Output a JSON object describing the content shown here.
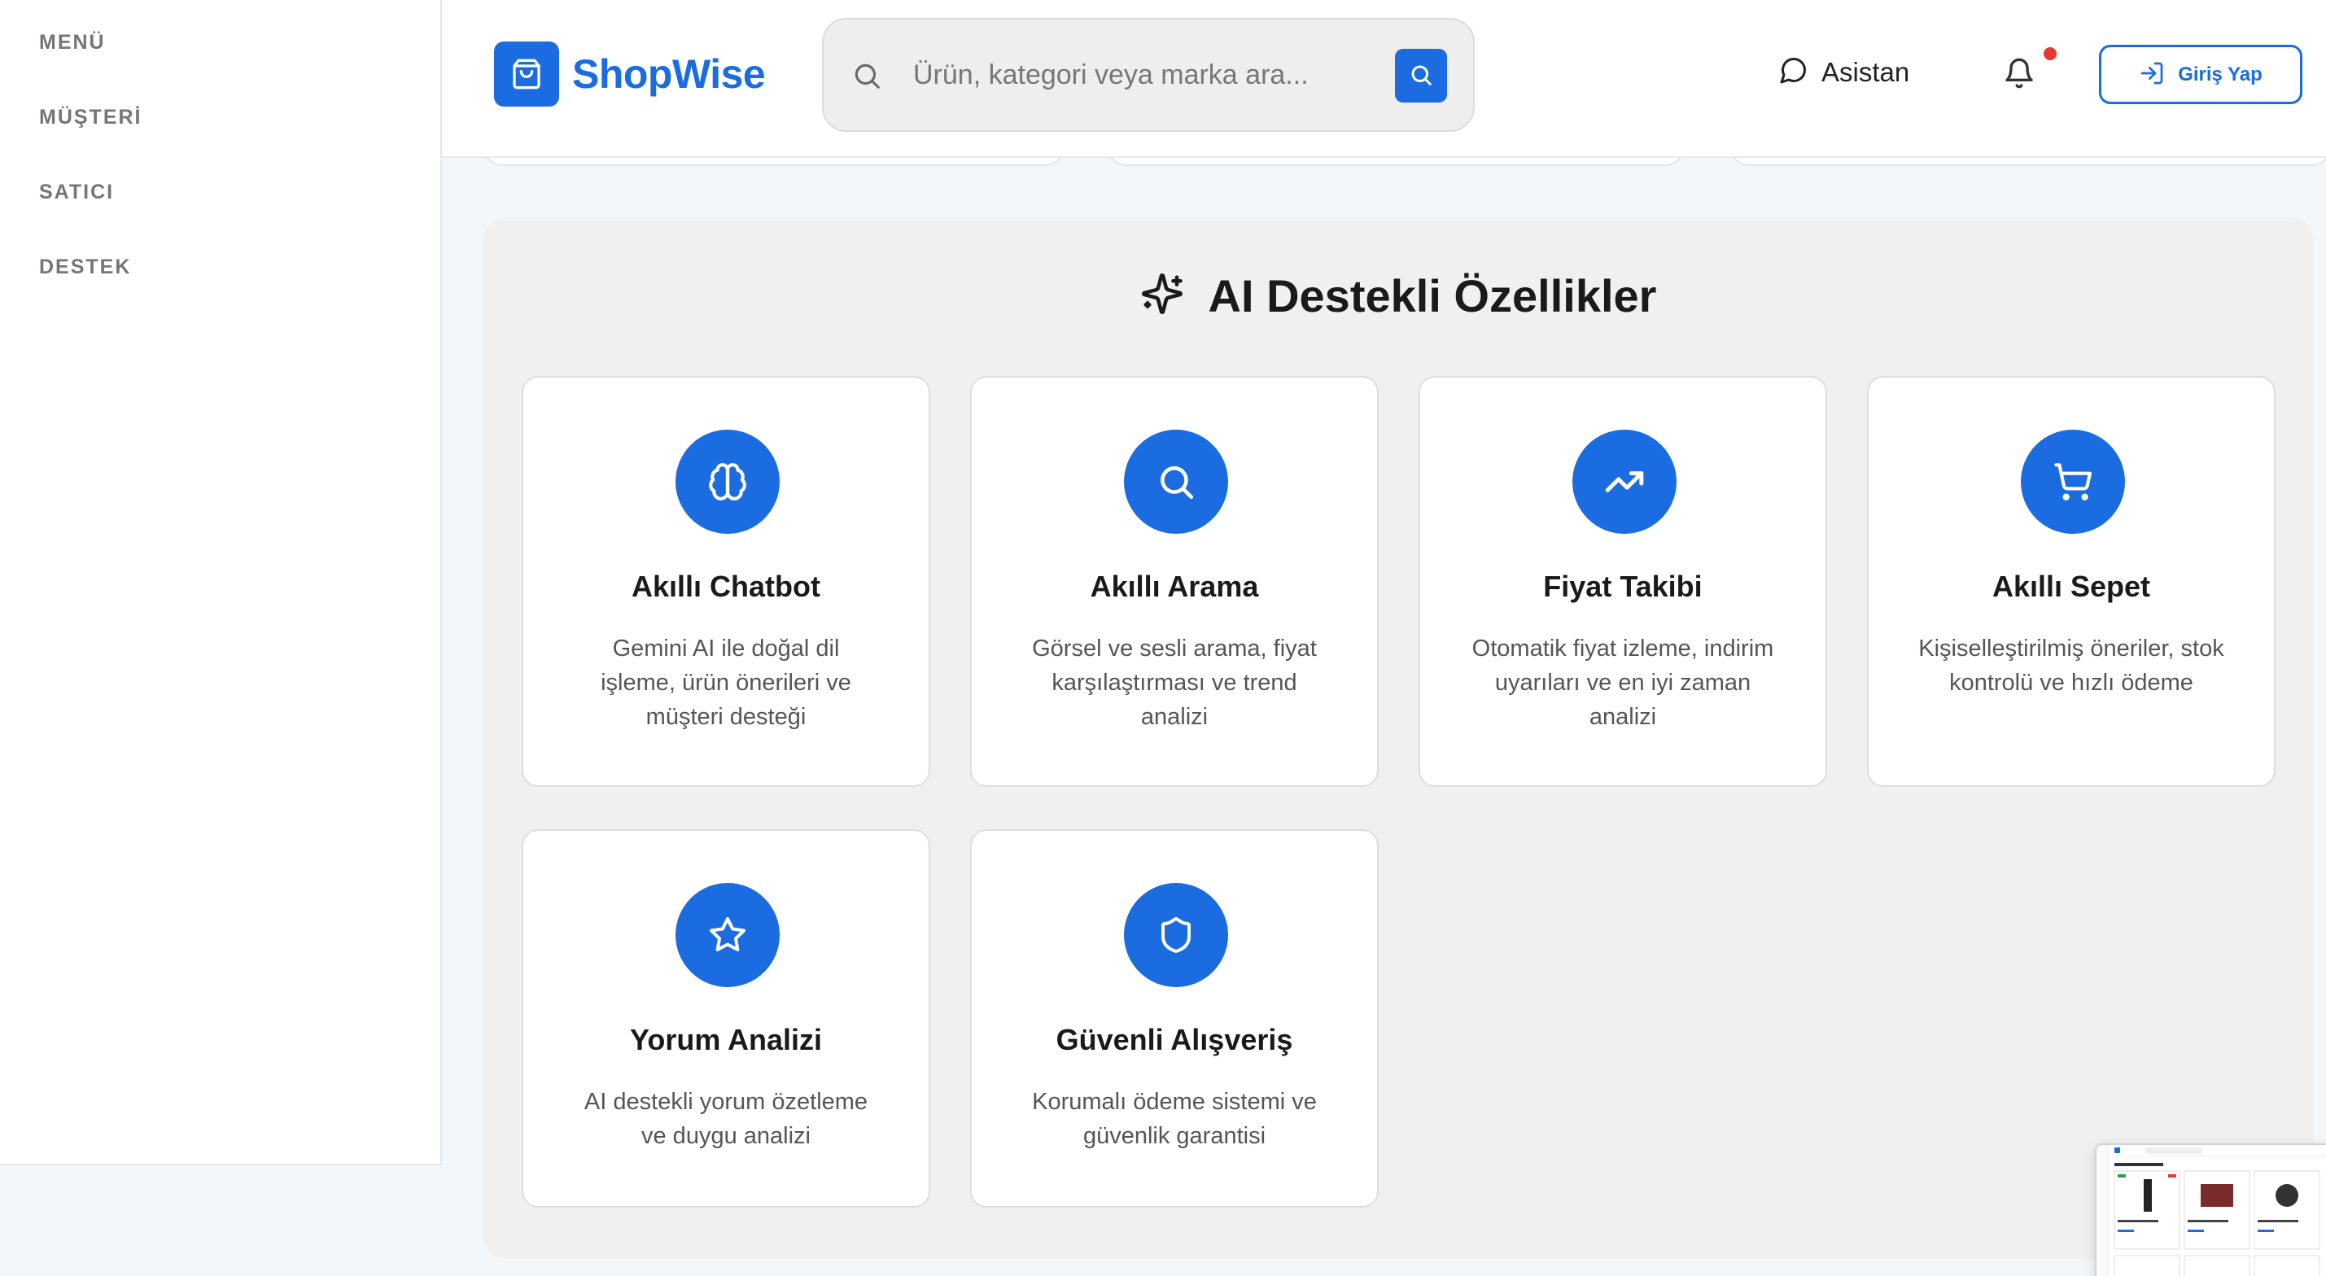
{
  "sidebar": {
    "items": [
      {
        "label": "MENÜ"
      },
      {
        "label": "MÜŞTERİ"
      },
      {
        "label": "SATICI"
      },
      {
        "label": "DESTEK"
      }
    ]
  },
  "header": {
    "brand": "ShopWise",
    "search_placeholder": "Ürün, kategori veya marka ara...",
    "assistant_label": "Asistan",
    "login_label": "Giriş Yap",
    "accent_color": "#1a6ce0",
    "notification_dot_color": "#e53935"
  },
  "features": {
    "title": "AI Destekli Özellikler",
    "title_icon": "sparkles-icon",
    "cards": [
      {
        "icon": "brain-icon",
        "title": "Akıllı Chatbot",
        "desc": "Gemini AI ile doğal dil işleme, ürün önerileri ve müşteri desteği"
      },
      {
        "icon": "search-icon",
        "title": "Akıllı Arama",
        "desc": "Görsel ve sesli arama, fiyat karşılaştırması ve trend analizi"
      },
      {
        "icon": "trending-up-icon",
        "title": "Fiyat Takibi",
        "desc": "Otomatik fiyat izleme, indirim uyarıları ve en iyi zaman analizi"
      },
      {
        "icon": "cart-icon",
        "title": "Akıllı Sepet",
        "desc": "Kişiselleştirilmiş öneriler, stok kontrolü ve hızlı ödeme"
      },
      {
        "icon": "star-icon",
        "title": "Yorum Analizi",
        "desc": "AI destekli yorum özetleme ve duygu analizi"
      },
      {
        "icon": "shield-icon",
        "title": "Güvenli Alışveriş",
        "desc": "Korumalı ödeme sistemi ve güvenlik garantisi"
      }
    ]
  },
  "thumbnail": {
    "brand": "ShopWise",
    "heading": "Öne Çıkan Ürünler"
  }
}
